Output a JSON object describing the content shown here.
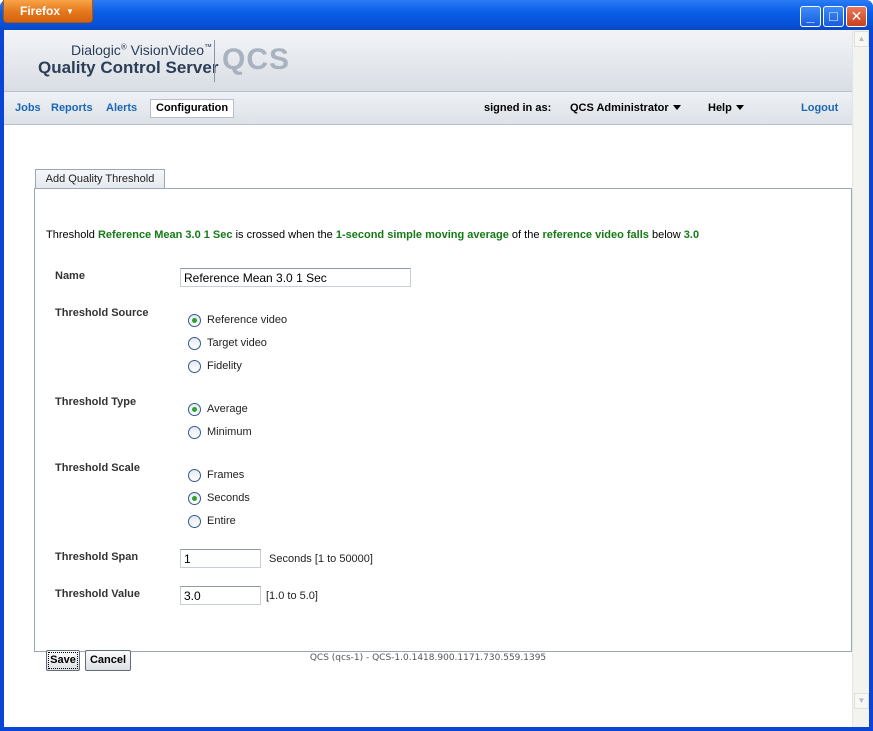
{
  "browser": {
    "menu_label": "Firefox",
    "window_buttons": {
      "minimize": "_",
      "maximize": "□",
      "close": "✕"
    }
  },
  "header": {
    "brand_line1": "Dialogic",
    "brand_reg": "®",
    "brand_product": "VisionVideo",
    "brand_tm": "™",
    "brand_line2": "Quality Control Server",
    "brand_mark": "QCS"
  },
  "nav": {
    "items": [
      {
        "label": "Jobs"
      },
      {
        "label": "Reports"
      },
      {
        "label": "Alerts"
      }
    ],
    "active": "Configuration",
    "signed_in_label": "signed in as:",
    "user": "QCS Administrator",
    "help": "Help",
    "logout": "Logout"
  },
  "tab": {
    "label": "Add Quality Threshold"
  },
  "summary": {
    "p1": "Threshold ",
    "name": "Reference Mean 3.0 1 Sec",
    "p2": " is crossed when the ",
    "average": "1-second simple moving average",
    "p3": " of the ",
    "source": "reference video falls",
    "p4": " below ",
    "value": "3.0"
  },
  "form": {
    "name_label": "Name",
    "name_value": "Reference Mean 3.0 1 Sec",
    "source_label": "Threshold Source",
    "source_options": [
      "Reference video",
      "Target video",
      "Fidelity"
    ],
    "source_selected": 0,
    "type_label": "Threshold Type",
    "type_options": [
      "Average",
      "Minimum"
    ],
    "type_selected": 0,
    "scale_label": "Threshold Scale",
    "scale_options": [
      "Frames",
      "Seconds",
      "Entire"
    ],
    "scale_selected": 1,
    "span_label": "Threshold Span",
    "span_value": "1",
    "span_hint": "Seconds [1 to 50000]",
    "value_label": "Threshold Value",
    "value_value": "3.0",
    "value_hint": "[1.0 to 5.0]",
    "save_label": "Save",
    "cancel_label": "Cancel"
  },
  "footer": {
    "text": "QCS (qcs-1) - QCS-1.0.1418.900.1171.730.559.1395"
  }
}
